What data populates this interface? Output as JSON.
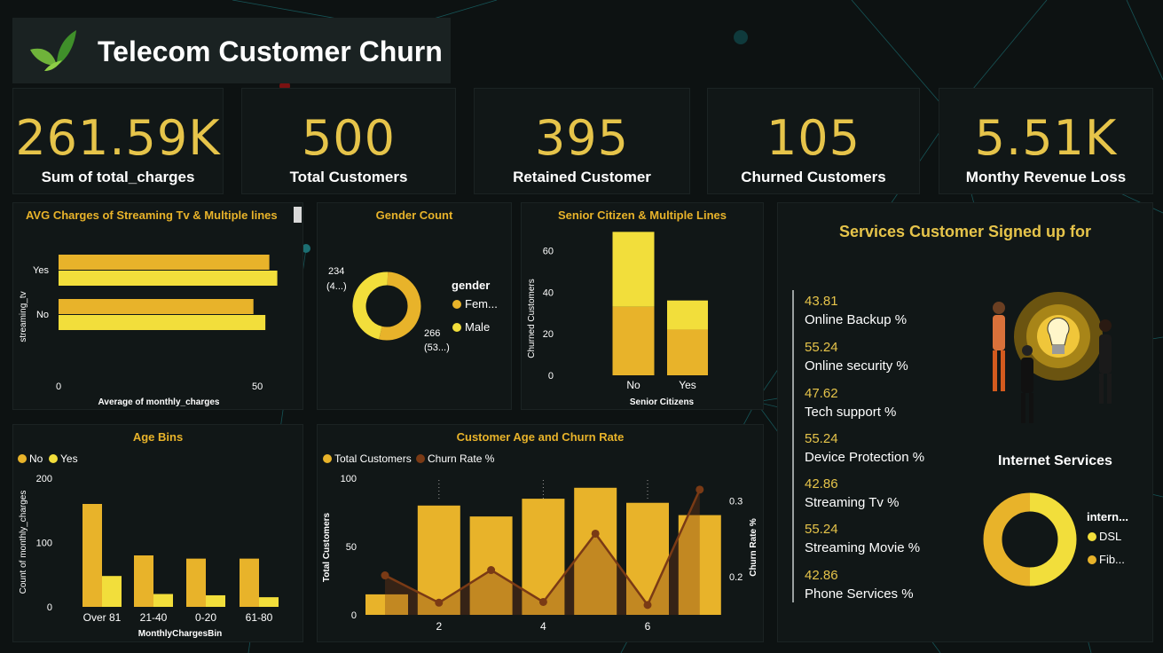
{
  "header": {
    "title": "Telecom Customer Churn",
    "logo_icon": "leaf-bird-logo"
  },
  "kpis": [
    {
      "value": "261.59K",
      "label": "Sum of total_charges"
    },
    {
      "value": "500",
      "label": "Total Customers"
    },
    {
      "value": "395",
      "label": "Retained Customer"
    },
    {
      "value": "105",
      "label": "Churned Customers"
    },
    {
      "value": "5.51K",
      "label": "Monthy Revenue Loss"
    }
  ],
  "colors": {
    "gold": "#e8b32a",
    "yellow": "#f2de3b",
    "brown": "#7a3a15",
    "text_gold": "#e6c44a"
  },
  "chart_data": [
    {
      "type": "bar",
      "orientation": "horizontal",
      "title": "AVG Charges of Streaming Tv & Multiple lines",
      "xlabel": "Average of monthly_charges",
      "ylabel": "streaming_tv",
      "categories": [
        "Yes",
        "No"
      ],
      "series": [
        {
          "values": [
            53,
            49
          ]
        },
        {
          "values": [
            55,
            52
          ]
        }
      ],
      "xlim": [
        0,
        60
      ],
      "xticks": [
        "0",
        "50"
      ]
    },
    {
      "type": "pie",
      "donut": true,
      "title": "Gender Count",
      "legend_title": "gender",
      "labels": [
        "Fem...",
        "Male"
      ],
      "values": [
        266,
        234
      ],
      "data_labels": [
        [
          "266",
          "(53...)"
        ],
        [
          "234",
          "(4...)"
        ]
      ]
    },
    {
      "type": "bar",
      "stacked": true,
      "title": "Senior Citizen & Multiple Lines",
      "xlabel": "Senior Citizens",
      "ylabel": "Churned Customers",
      "categories": [
        "No",
        "Yes"
      ],
      "series": [
        {
          "values": [
            33,
            22
          ]
        },
        {
          "values": [
            36,
            14
          ]
        }
      ],
      "ylim": [
        0,
        70
      ],
      "yticks": [
        "0",
        "20",
        "40",
        "60"
      ]
    },
    {
      "type": "bar",
      "title": "Age Bins",
      "xlabel": "MonthlyChargesBin",
      "ylabel": "Count of monthly_charges",
      "categories": [
        "Over 81",
        "21-40",
        "0-20",
        "61-80"
      ],
      "series": [
        {
          "name": "No",
          "values": [
            160,
            80,
            75,
            75
          ]
        },
        {
          "name": "Yes",
          "values": [
            48,
            20,
            18,
            15
          ]
        }
      ],
      "ylim": [
        0,
        200
      ],
      "yticks": [
        "0",
        "100",
        "200"
      ]
    },
    {
      "type": "bar",
      "title": "Customer Age and Churn Rate",
      "xlabel": "",
      "ylabel": "Total Customers",
      "y2label": "Churn Rate %",
      "x": [
        1,
        2,
        3,
        4,
        5,
        6,
        7
      ],
      "xticks": [
        "2",
        "4",
        "6"
      ],
      "series": [
        {
          "name": "Total Customers",
          "values": [
            15,
            80,
            72,
            85,
            93,
            82,
            73
          ]
        },
        {
          "name": "Churn Rate %",
          "values": [
            0.202,
            0.166,
            0.209,
            0.167,
            0.257,
            0.163,
            0.315
          ]
        }
      ],
      "ylim": [
        0,
        100
      ],
      "yticks": [
        "0",
        "50",
        "100"
      ],
      "y2lim": [
        0.15,
        0.33
      ],
      "y2ticks": [
        "0.2",
        "0.3"
      ]
    },
    {
      "type": "pie",
      "donut": true,
      "title": "Internet Services",
      "legend_title": "intern...",
      "labels": [
        "DSL",
        "Fib..."
      ],
      "values": [
        50,
        50
      ]
    }
  ],
  "services": {
    "title": "Services Customer Signed up for",
    "items": [
      {
        "pct": "43.81",
        "name": "Online Backup %"
      },
      {
        "pct": "55.24",
        "name": "Online security %"
      },
      {
        "pct": "47.62",
        "name": "Tech support %"
      },
      {
        "pct": "55.24",
        "name": "Device Protection %"
      },
      {
        "pct": "42.86",
        "name": "Streaming Tv %"
      },
      {
        "pct": "55.24",
        "name": "Streaming Movie %"
      },
      {
        "pct": "42.86",
        "name": "Phone Services %"
      }
    ],
    "illustration_icon": "lightbulb-business-people-illustration"
  }
}
